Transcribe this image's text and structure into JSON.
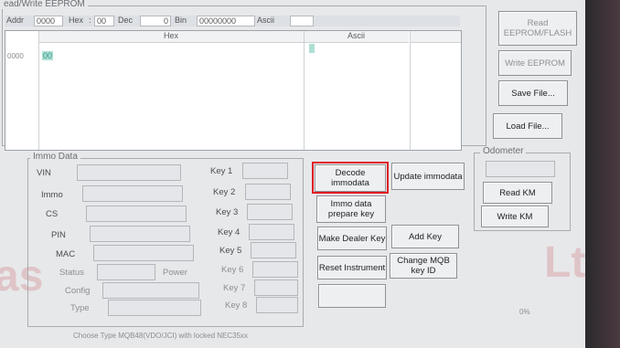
{
  "window": {
    "title": "ead/Write EEPROM"
  },
  "toolbar": {
    "addr_label": "Addr",
    "addr_value": "0000",
    "hex_label": "Hex",
    "hex_value": "00",
    "dec_label": "Dec",
    "dec_value": "0",
    "bin_label": "Bin",
    "bin_value": "00000000",
    "ascii_label": "Ascii"
  },
  "grid": {
    "col_hex": "Hex",
    "col_ascii": "Ascii",
    "row_addr": "0000",
    "sel_byte": "00"
  },
  "right_buttons": {
    "read": "Read EEPROM/FLASH",
    "write": "Write EEPROM",
    "save": "Save File...",
    "load": "Load File..."
  },
  "immo": {
    "title": "Immo Data",
    "vin": "VIN",
    "immo": "Immo",
    "cs": "CS",
    "pin": "PIN",
    "mac": "MAC",
    "status": "Status",
    "power": "Power",
    "config": "Config",
    "type": "Type"
  },
  "keys": [
    "Key 1",
    "Key 2",
    "Key 3",
    "Key 4",
    "Key 5",
    "Key 6",
    "Key 7",
    "Key 8"
  ],
  "actions": {
    "decode": "Decode immodata",
    "update": "Update immodata",
    "prepare": "Immo data prepare key",
    "dealer": "Make Dealer Key",
    "add": "Add Key",
    "reset": "Reset Instrument",
    "change": "Change MQB key ID"
  },
  "odometer": {
    "title": "Odometer",
    "read": "Read KM",
    "write": "Write KM"
  },
  "statusbar": {
    "text": "Choose Type MQB48(VDO/JCI) with locked NEC35xx",
    "percent": "0%"
  },
  "colors": {
    "highlight": "#e01b24",
    "selection": "#aedfd4"
  }
}
